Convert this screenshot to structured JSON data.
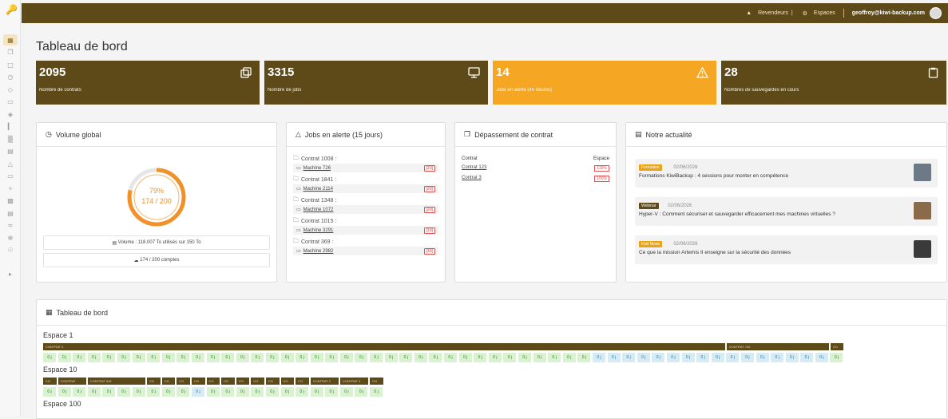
{
  "sidebar": {
    "items": [
      "grid-icon",
      "copy-icon",
      "file-icon",
      "history-icon",
      "tag-icon",
      "card-icon",
      "layers-icon",
      "chart-icon",
      "bar-chart-icon",
      "doc-icon",
      "alert-icon",
      "monitor-icon",
      "wrench-icon",
      "archive-icon",
      "box-icon",
      "signal-icon",
      "plug-icon",
      "users-icon",
      "expand-icon"
    ]
  },
  "topbar": {
    "resellers": "Revendeurs",
    "spaces": "Espaces",
    "user_email": "geoffroy@kiwi-backup.com"
  },
  "page": {
    "title": "Tableau de bord"
  },
  "stats": [
    {
      "value": "2095",
      "label": "Nombre de contrats",
      "icon": "copy-icon",
      "color": "#5e4a18"
    },
    {
      "value": "3315",
      "label": "Nombre de jobs",
      "icon": "monitor-icon",
      "color": "#5e4a18"
    },
    {
      "value": "14",
      "label": "Jobs en alerte (40 heures)",
      "icon": "alert-icon",
      "color": "#f5a623"
    },
    {
      "value": "28",
      "label": "Nombres de sauvegardes en cours",
      "icon": "clipboard-icon",
      "color": "#5e4a18"
    }
  ],
  "volume": {
    "title": "Volume global",
    "percent_text": "79%",
    "ratio_text": "174 / 200",
    "fill_fraction": 0.79,
    "volume_line": "Volume : 118.007 To utilisés sur 150 To",
    "accounts_line": "174 / 200 comptes"
  },
  "alerts": {
    "title": "Jobs en alerte (15 jours)",
    "items": [
      {
        "contract": "Contrat 1008 :",
        "machine": "Machine 726",
        "badge": "[23]"
      },
      {
        "contract": "Contrat 1841 :",
        "machine": "Machine 2114",
        "badge": "[20]"
      },
      {
        "contract": "Contrat 1348 :",
        "machine": "Machine 1072",
        "badge": "[20]"
      },
      {
        "contract": "Contrat 1015 :",
        "machine": "Machine 3291",
        "badge": "[19]"
      },
      {
        "contract": "Contrat 369 :",
        "machine": "Machine 2982",
        "badge": "[16]"
      }
    ]
  },
  "overflow": {
    "title": "Dépassement de contrat",
    "col_contract": "Contrat",
    "col_space": "Espace",
    "rows": [
      {
        "contract": "Contrat 123",
        "badge": "133%"
      },
      {
        "contract": "Contrat 3",
        "badge": "100%"
      }
    ]
  },
  "news": {
    "title": "Notre actualité",
    "items": [
      {
        "tag": "Formation",
        "tag_color": "#e8a317",
        "date": "02/06/2026",
        "text": "Formations KiwiBackup : 4 sessions pour monter en compétence"
      },
      {
        "tag": "Webinar",
        "tag_color": "#5e4a18",
        "date": "02/06/2026",
        "text": "Hyper-V : Comment sécuriser et sauvegarder efficacement mes machines virtuelles ?"
      },
      {
        "tag": "Kiwi News",
        "tag_color": "#e8a317",
        "date": "02/06/2026",
        "text": "Ce que la mission Artemis II enseigne sur la sécurité des données"
      }
    ]
  },
  "dashboard": {
    "title": "Tableau de bord",
    "spaces": [
      {
        "name": "Espace 1",
        "contracts": [
          {
            "label": "CONTRAT 2",
            "span": 46
          },
          {
            "label": "CONTRAT 740",
            "span": 7
          },
          {
            "label": "CO",
            "span": 1
          }
        ],
        "jobs_label": "0 j",
        "jobs_count": 54,
        "blue_from": 37,
        "blue_to": 52
      },
      {
        "name": "Espace 10",
        "contracts": [
          {
            "label": "CO",
            "span": 1
          },
          {
            "label": "CONTRAT",
            "span": 2
          },
          {
            "label": "CONTRAT 516",
            "span": 4
          },
          {
            "label": "CO",
            "span": 1
          },
          {
            "label": "CO",
            "span": 1
          },
          {
            "label": "CO",
            "span": 1
          },
          {
            "label": "CO",
            "span": 1
          },
          {
            "label": "CO",
            "span": 1
          },
          {
            "label": "CO",
            "span": 1
          },
          {
            "label": "CO",
            "span": 1
          },
          {
            "label": "CO",
            "span": 1
          },
          {
            "label": "CO",
            "span": 1
          },
          {
            "label": "CO",
            "span": 1
          },
          {
            "label": "CO",
            "span": 1
          },
          {
            "label": "CONTRAT 2",
            "span": 2
          },
          {
            "label": "CONTRAT 2",
            "span": 2
          },
          {
            "label": "CO",
            "span": 1
          }
        ],
        "jobs_label": "0 j",
        "jobs_count": 23,
        "blue_from": 10,
        "blue_to": 10
      },
      {
        "name": "Espace 100"
      }
    ]
  }
}
